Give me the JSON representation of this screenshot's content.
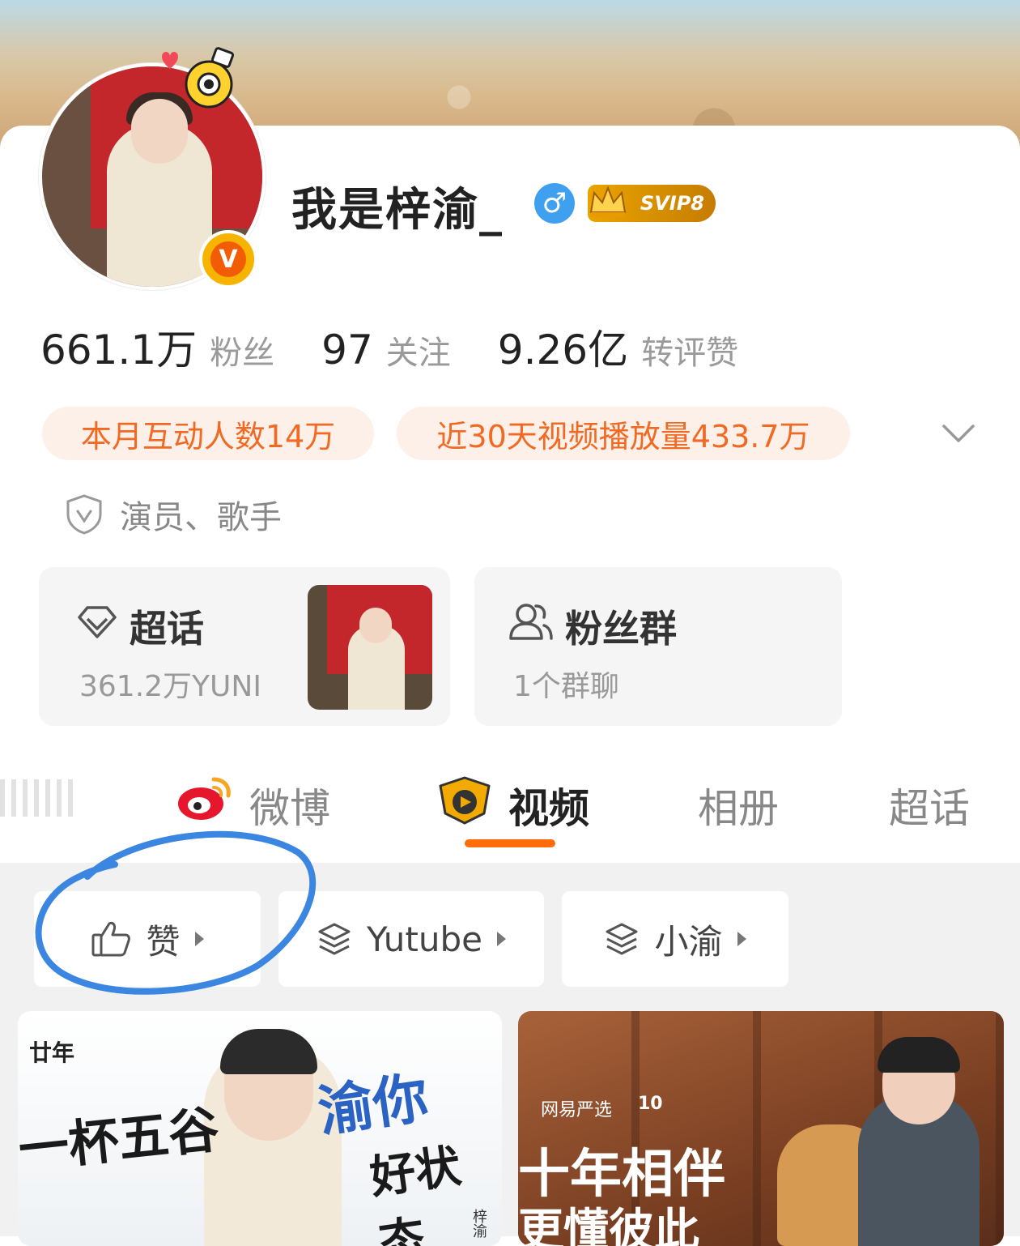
{
  "profile": {
    "name": "我是梓渝_",
    "gender_symbol": "♂",
    "vip_badge": "SVIP8",
    "verified_mark": "V",
    "stats": [
      {
        "value": "661.1万",
        "label": "粉丝"
      },
      {
        "value": "97",
        "label": "关注"
      },
      {
        "value": "9.26亿",
        "label": "转评赞"
      }
    ],
    "highlights": [
      "本月互动人数14万",
      "近30天视频播放量433.7万"
    ],
    "occupation": "演员、歌手",
    "cards": {
      "supertopic": {
        "title": "超话",
        "sub": "361.2万YUNI"
      },
      "fangroup": {
        "title": "粉丝群",
        "sub": "1个群聊"
      }
    }
  },
  "tabs": [
    {
      "label": "微博",
      "icon": "weibo-icon"
    },
    {
      "label": "视频",
      "icon": "video-icon",
      "active": true
    },
    {
      "label": "相册"
    },
    {
      "label": "超话"
    }
  ],
  "filters": [
    {
      "label": "赞",
      "icon": "thumbs-up-icon"
    },
    {
      "label": "Yutube",
      "icon": "layers-icon"
    },
    {
      "label": "小渝",
      "icon": "layers-icon"
    }
  ],
  "videos": [
    {
      "texts": [
        "廿年",
        "一杯五谷",
        "渝你",
        "好状态",
        "梓渝"
      ]
    },
    {
      "texts": [
        "网易严选",
        "10",
        "十年相伴",
        "更懂彼此"
      ]
    }
  ],
  "colors": {
    "accent": "#ff6d0b",
    "pill_text": "#f06a24",
    "pill_bg": "#fdf0e8",
    "annotation": "#3b86e0"
  }
}
